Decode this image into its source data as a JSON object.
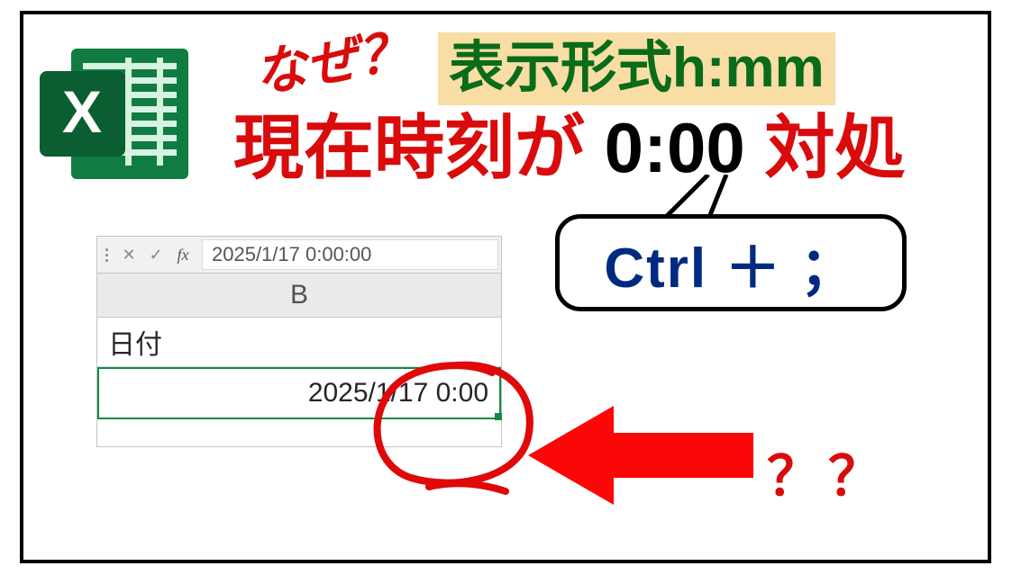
{
  "why_label": "なぜ？",
  "format_banner": "表示形式h:mm",
  "headline": {
    "part1": "現在時刻が",
    "part2": " 0:00 ",
    "part3": "対処"
  },
  "callout_text": "Ctrl ＋ ；",
  "excel": {
    "formula_value": "2025/1/17  0:00:00",
    "column_header": "B",
    "row1_label": "日付",
    "row2_value": "2025/1/17 0:00"
  },
  "question_marks": "？？",
  "colors": {
    "red": "#d90b0b",
    "banner_bg": "#f8dda4",
    "banner_fg": "#0a6b1a",
    "callout_fg": "#002a80",
    "excel_green": "#118a42"
  }
}
